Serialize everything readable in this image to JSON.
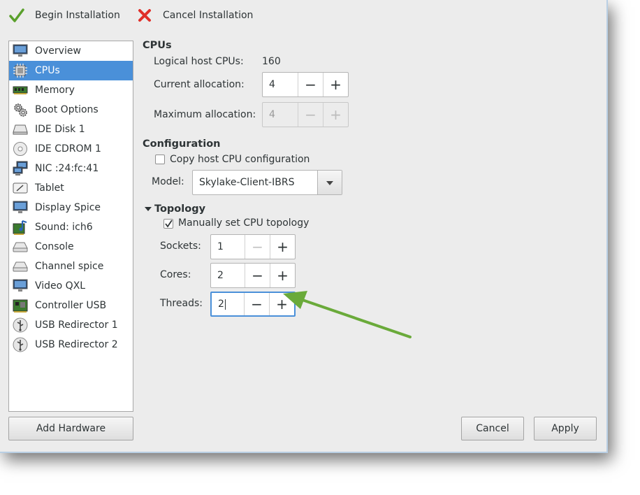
{
  "toolbar": {
    "begin_label": "Begin Installation",
    "cancel_label": "Cancel Installation"
  },
  "hardware": {
    "items": [
      {
        "label": "Overview",
        "icon": "overview-icon"
      },
      {
        "label": "CPUs",
        "icon": "cpu-icon"
      },
      {
        "label": "Memory",
        "icon": "memory-icon"
      },
      {
        "label": "Boot Options",
        "icon": "gears-icon"
      },
      {
        "label": "IDE Disk 1",
        "icon": "disk-icon"
      },
      {
        "label": "IDE CDROM 1",
        "icon": "cdrom-icon"
      },
      {
        "label": "NIC :24:fc:41",
        "icon": "nic-icon"
      },
      {
        "label": "Tablet",
        "icon": "tablet-icon"
      },
      {
        "label": "Display Spice",
        "icon": "display-icon"
      },
      {
        "label": "Sound: ich6",
        "icon": "sound-icon"
      },
      {
        "label": "Console",
        "icon": "console-icon"
      },
      {
        "label": "Channel spice",
        "icon": "channel-icon"
      },
      {
        "label": "Video QXL",
        "icon": "video-icon"
      },
      {
        "label": "Controller USB",
        "icon": "controller-icon"
      },
      {
        "label": "USB Redirector 1",
        "icon": "usb-icon"
      },
      {
        "label": "USB Redirector 2",
        "icon": "usb-icon"
      }
    ],
    "selected": "CPUs",
    "add_label": "Add Hardware"
  },
  "cpus": {
    "title": "CPUs",
    "logical_label": "Logical host CPUs:",
    "logical_value": "160",
    "current_label": "Current allocation:",
    "current_value": "4",
    "max_label": "Maximum allocation:",
    "max_value": "4"
  },
  "configuration": {
    "title": "Configuration",
    "copy_host_label": "Copy host CPU configuration",
    "copy_host_checked": false,
    "model_label": "Model:",
    "model_value": "Skylake-Client-IBRS"
  },
  "topology": {
    "title": "Topology",
    "manual_label": "Manually set CPU topology",
    "manual_checked": true,
    "sockets_label": "Sockets:",
    "sockets_value": "1",
    "cores_label": "Cores:",
    "cores_value": "2",
    "threads_label": "Threads:",
    "threads_value": "2"
  },
  "footer": {
    "cancel_label": "Cancel",
    "apply_label": "Apply"
  },
  "colors": {
    "selection": "#4a90d9",
    "annotation_arrow": "#6aaa3a"
  }
}
